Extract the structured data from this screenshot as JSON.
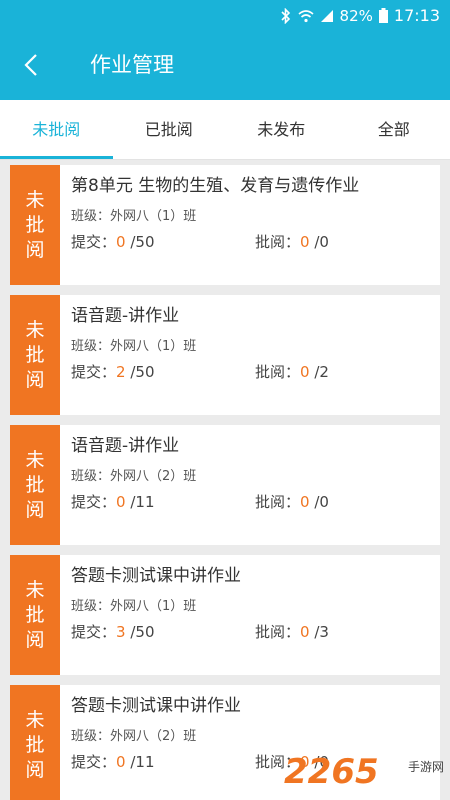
{
  "status_bar": {
    "battery": "82%",
    "time": "17:13",
    "icons": [
      "bluetooth-icon",
      "wifi-icon",
      "signal-icon",
      "battery-icon"
    ]
  },
  "header": {
    "title": "作业管理",
    "back_icon": "back-chevron-icon"
  },
  "tabs": [
    {
      "label": "未批阅",
      "active": true
    },
    {
      "label": "已批阅",
      "active": false
    },
    {
      "label": "未发布",
      "active": false
    },
    {
      "label": "全部",
      "active": false
    }
  ],
  "labels": {
    "submit": "提交：",
    "review": "批阅："
  },
  "assignments": [
    {
      "status_chars": [
        "未",
        "批",
        "阅"
      ],
      "title": "第8单元 生物的生殖、发育与遗传作业",
      "class": "班级：外网八（1）班",
      "submitted": "0",
      "submit_total": "/50",
      "reviewed": "0",
      "review_total": "/0"
    },
    {
      "status_chars": [
        "未",
        "批",
        "阅"
      ],
      "title": "语音题-讲作业",
      "class": "班级：外网八（1）班",
      "submitted": "2",
      "submit_total": "/50",
      "reviewed": "0",
      "review_total": "/2"
    },
    {
      "status_chars": [
        "未",
        "批",
        "阅"
      ],
      "title": "语音题-讲作业",
      "class": "班级：外网八（2）班",
      "submitted": "0",
      "submit_total": "/11",
      "reviewed": "0",
      "review_total": "/0"
    },
    {
      "status_chars": [
        "未",
        "批",
        "阅"
      ],
      "title": "答题卡测试课中讲作业",
      "class": "班级：外网八（1）班",
      "submitted": "3",
      "submit_total": "/50",
      "reviewed": "0",
      "review_total": "/3"
    },
    {
      "status_chars": [
        "未",
        "批",
        "阅"
      ],
      "title": "答题卡测试课中讲作业",
      "class": "班级：外网八（2）班",
      "submitted": "0",
      "submit_total": "/11",
      "reviewed": "0",
      "review_total": "/0"
    }
  ],
  "watermark": {
    "digits": "2265",
    "text": "手游网"
  },
  "colors": {
    "primary": "#1ab3d8",
    "accent": "#f07522",
    "background": "#ebebeb"
  }
}
